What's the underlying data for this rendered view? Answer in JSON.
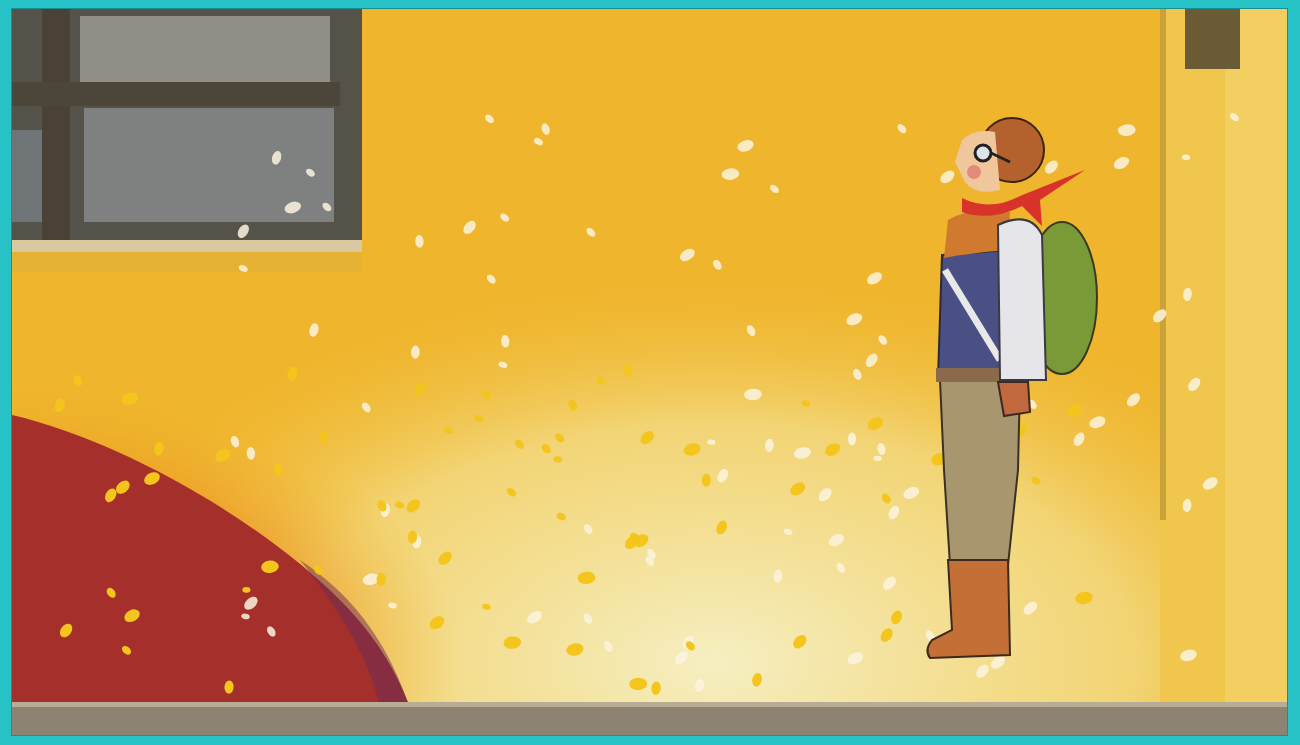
{
  "image": {
    "kind": "photo"
  }
}
